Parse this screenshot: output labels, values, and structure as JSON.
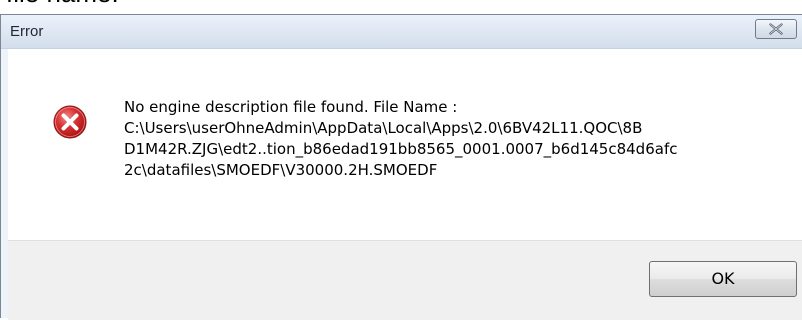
{
  "background_fragment": {
    "text": "file name:"
  },
  "dialog": {
    "title": "Error",
    "close_icon": "close-x-icon",
    "message_icon": "error-icon",
    "message_lines": [
      "No engine description file found. File Name :",
      "C:\\Users\\userOhneAdmin\\AppData\\Local\\Apps\\2.0\\6BV42L11.QOC\\8B",
      "D1M42R.ZJG\\edt2..tion_b86edad191bb8565_0001.0007_b6d145c84d6afc",
      "2c\\datafiles\\SMOEDF\\V30000.2H.SMOEDF"
    ],
    "ok_label": "OK"
  },
  "colors": {
    "error_red": "#d32f2f",
    "content_bg": "#ffffff",
    "footer_bg": "#f0f0f0",
    "title_bar": "#dfe8f3"
  }
}
